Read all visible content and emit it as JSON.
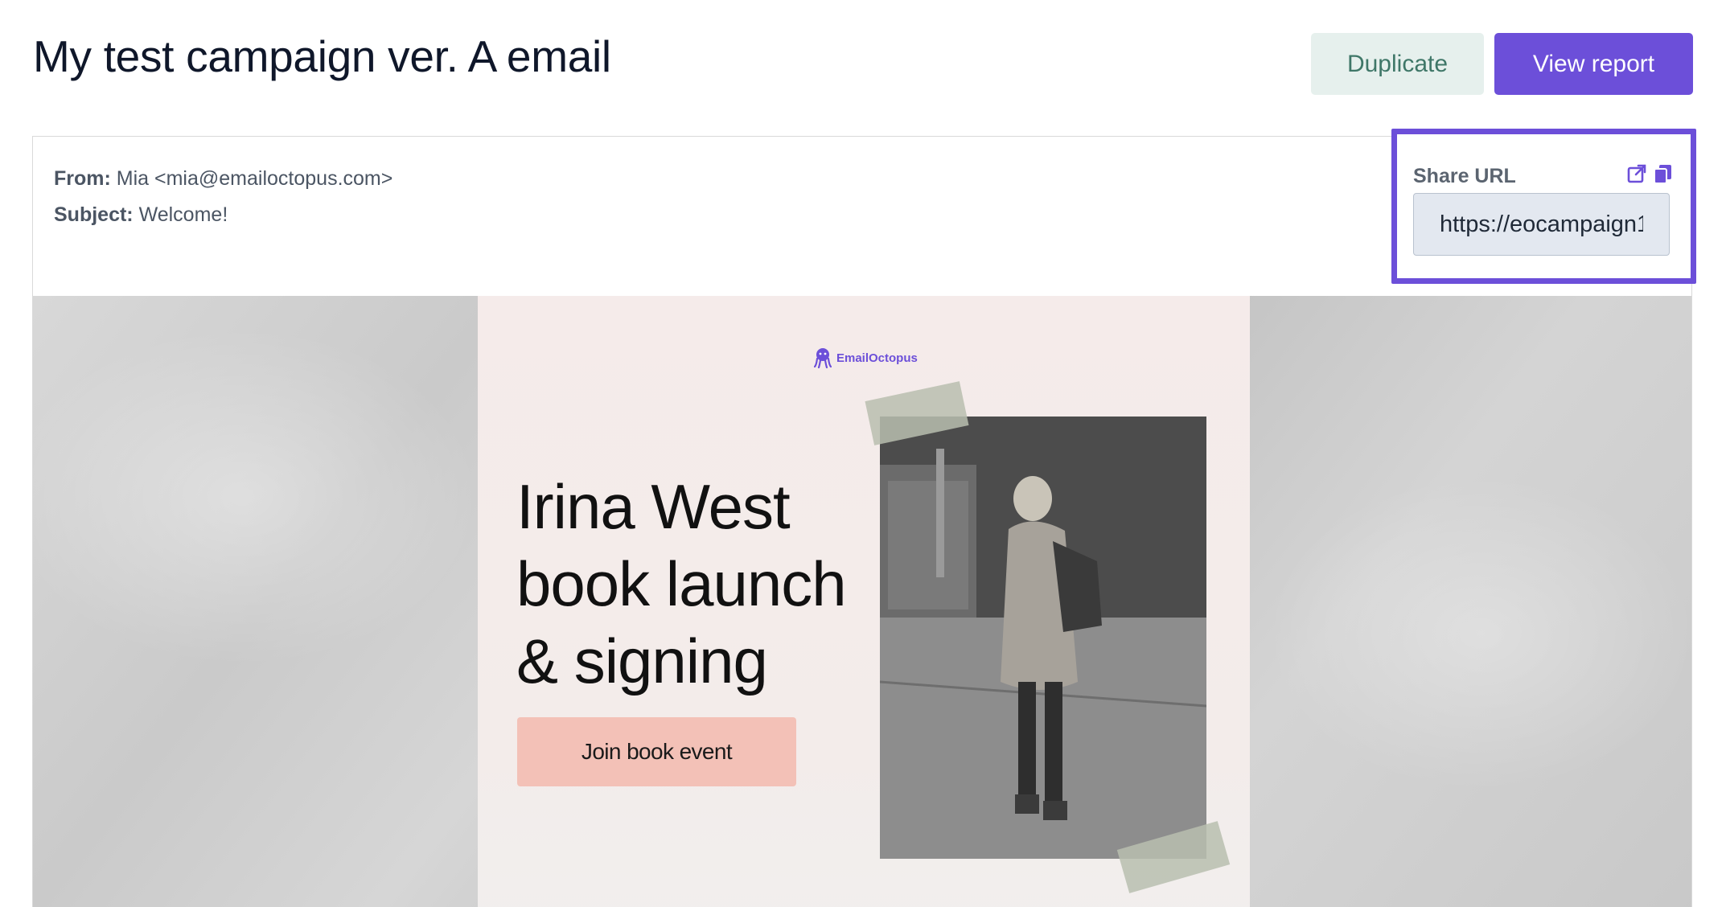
{
  "header": {
    "title": "My test campaign ver. A email",
    "duplicate_label": "Duplicate",
    "view_report_label": "View report"
  },
  "meta": {
    "from_label": "From:",
    "from_value": "Mia <mia@emailoctopus.com>",
    "subject_label": "Subject:",
    "subject_value": "Welcome!"
  },
  "share": {
    "label": "Share URL",
    "url": "https://eocampaign1",
    "icons": [
      "open-external-icon",
      "copy-icon"
    ]
  },
  "email": {
    "brand": "EmailOctopus",
    "headline": [
      "Irina West",
      "book launch",
      "& signing"
    ],
    "cta_label": "Join book event"
  },
  "colors": {
    "accent": "#6c4fd9",
    "duplicate_bg": "#e6f0ed",
    "cta_bg": "#f3c1b7"
  }
}
